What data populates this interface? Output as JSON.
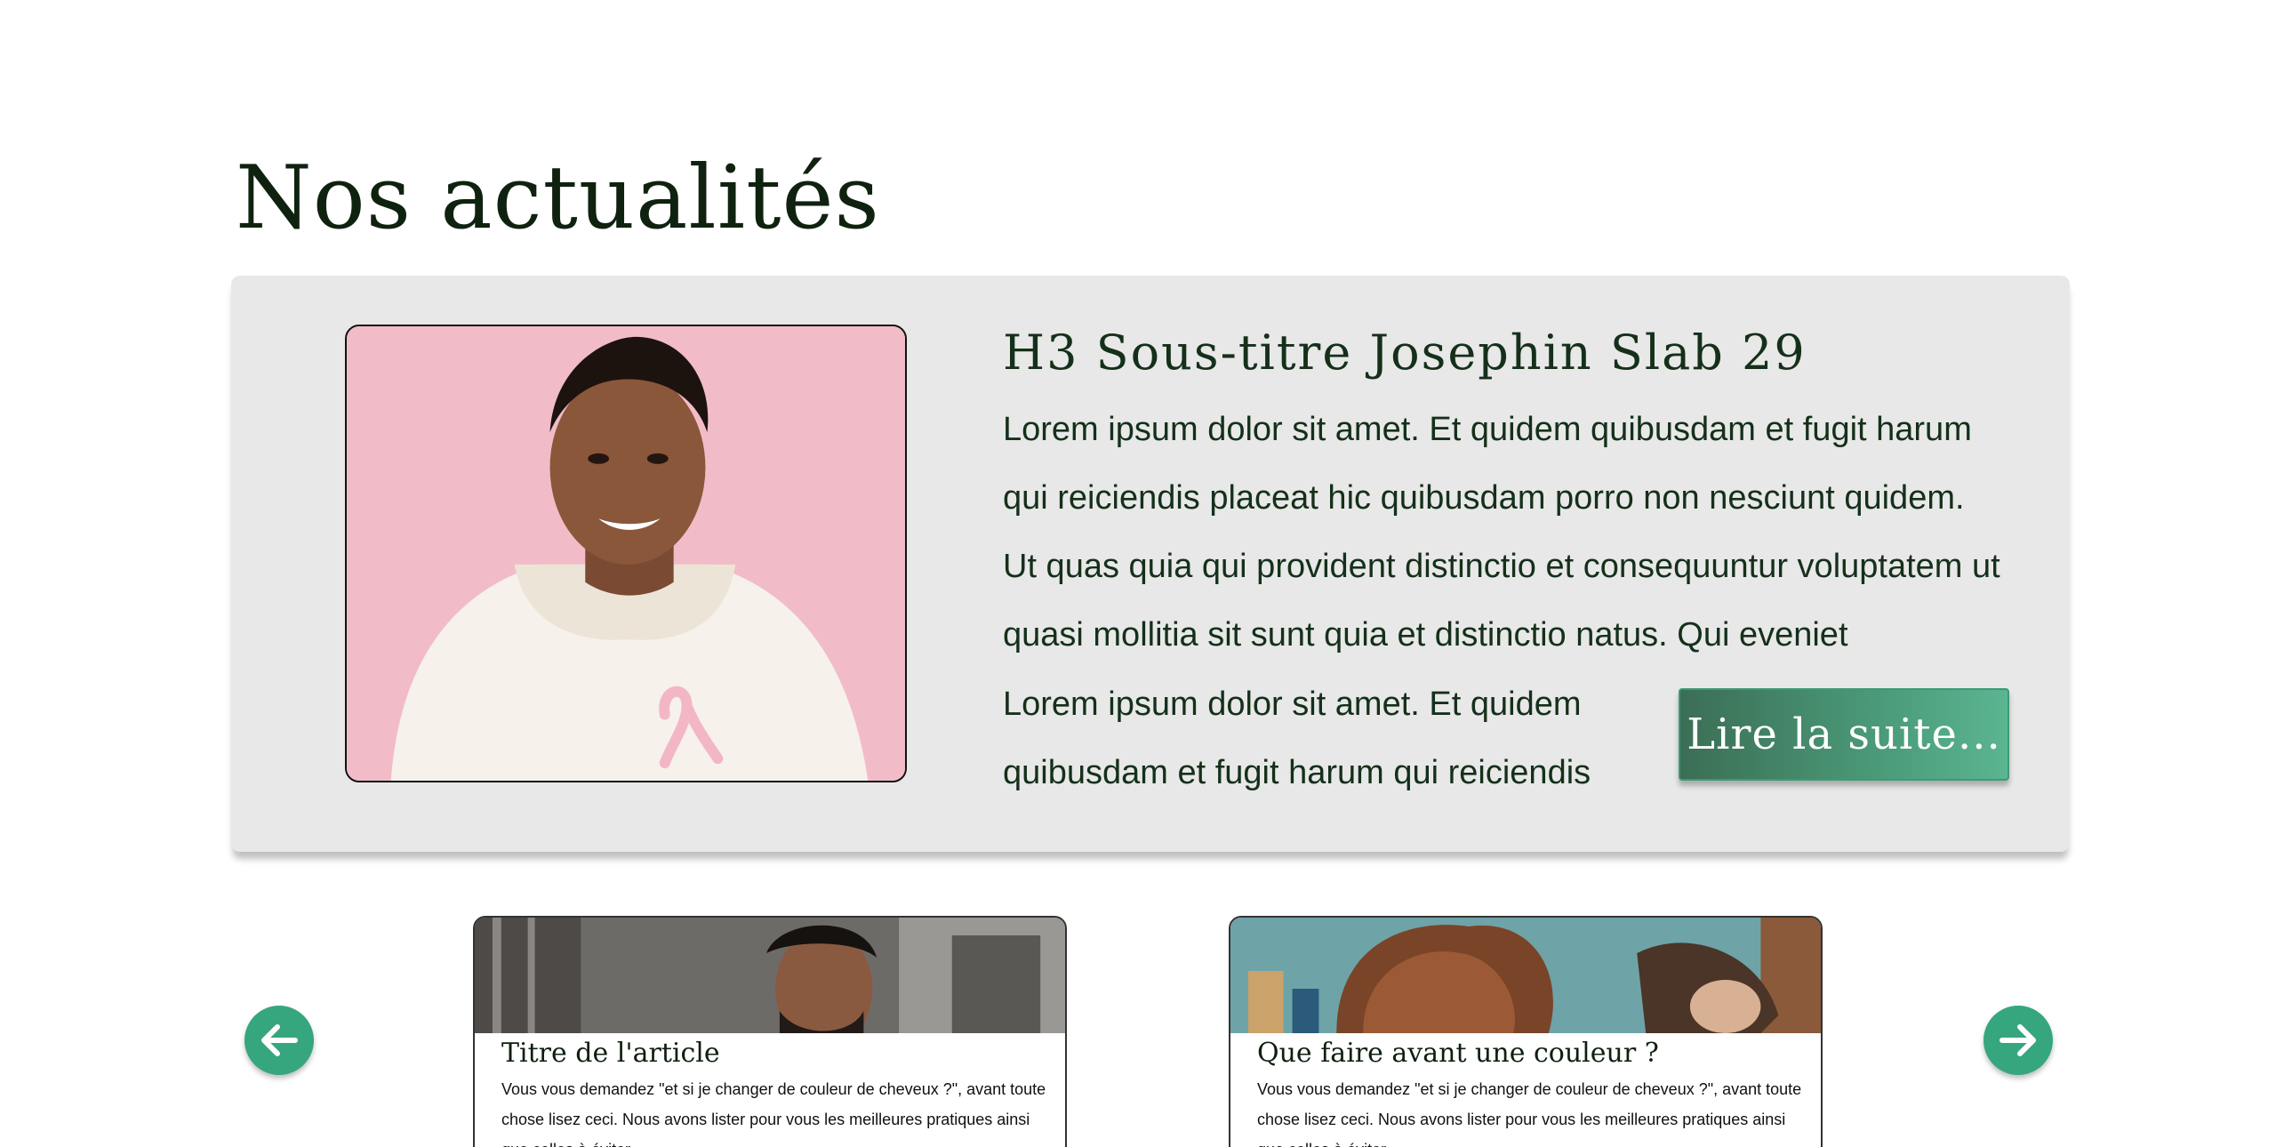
{
  "section": {
    "title": "Nos actualités"
  },
  "featured": {
    "image_alt": "Smiling woman in white hoodie with pink ribbon",
    "subtitle": "H3 Sous-titre Josephin Slab 29",
    "body": "Lorem ipsum dolor sit amet. Et quidem quibusdam et fugit harum qui reiciendis placeat hic quibusdam porro non nesciunt quidem. Ut quas quia qui provident distinctio et consequuntur voluptatem ut quasi mollitia sit sunt quia et distinctio natus. Qui eveniet",
    "body_end": "Lorem ipsum dolor sit amet. Et quidem quibusdam et fugit harum qui reiciendis",
    "read_more_label": "Lire la suite..."
  },
  "carousel": {
    "prev_icon": "arrow-left-icon",
    "next_icon": "arrow-right-icon",
    "articles": [
      {
        "title": "Titre de l'article",
        "excerpt": "Vous vous demandez \"et si je changer de couleur de cheveux ?\", avant toute chose lisez ceci. Nous avons lister pour vous les meilleures pratiques ainsi que celles à éviter."
      },
      {
        "title": "Que faire avant une couleur ?",
        "excerpt": "Vous vous demandez \"et si je changer de couleur de cheveux ?\", avant toute chose lisez ceci. Nous avons lister pour vous les meilleures pratiques ainsi que celles à éviter."
      }
    ]
  },
  "colors": {
    "accent": "#36a67e",
    "card_bg": "#e8e8e8",
    "text": "#15301a"
  }
}
